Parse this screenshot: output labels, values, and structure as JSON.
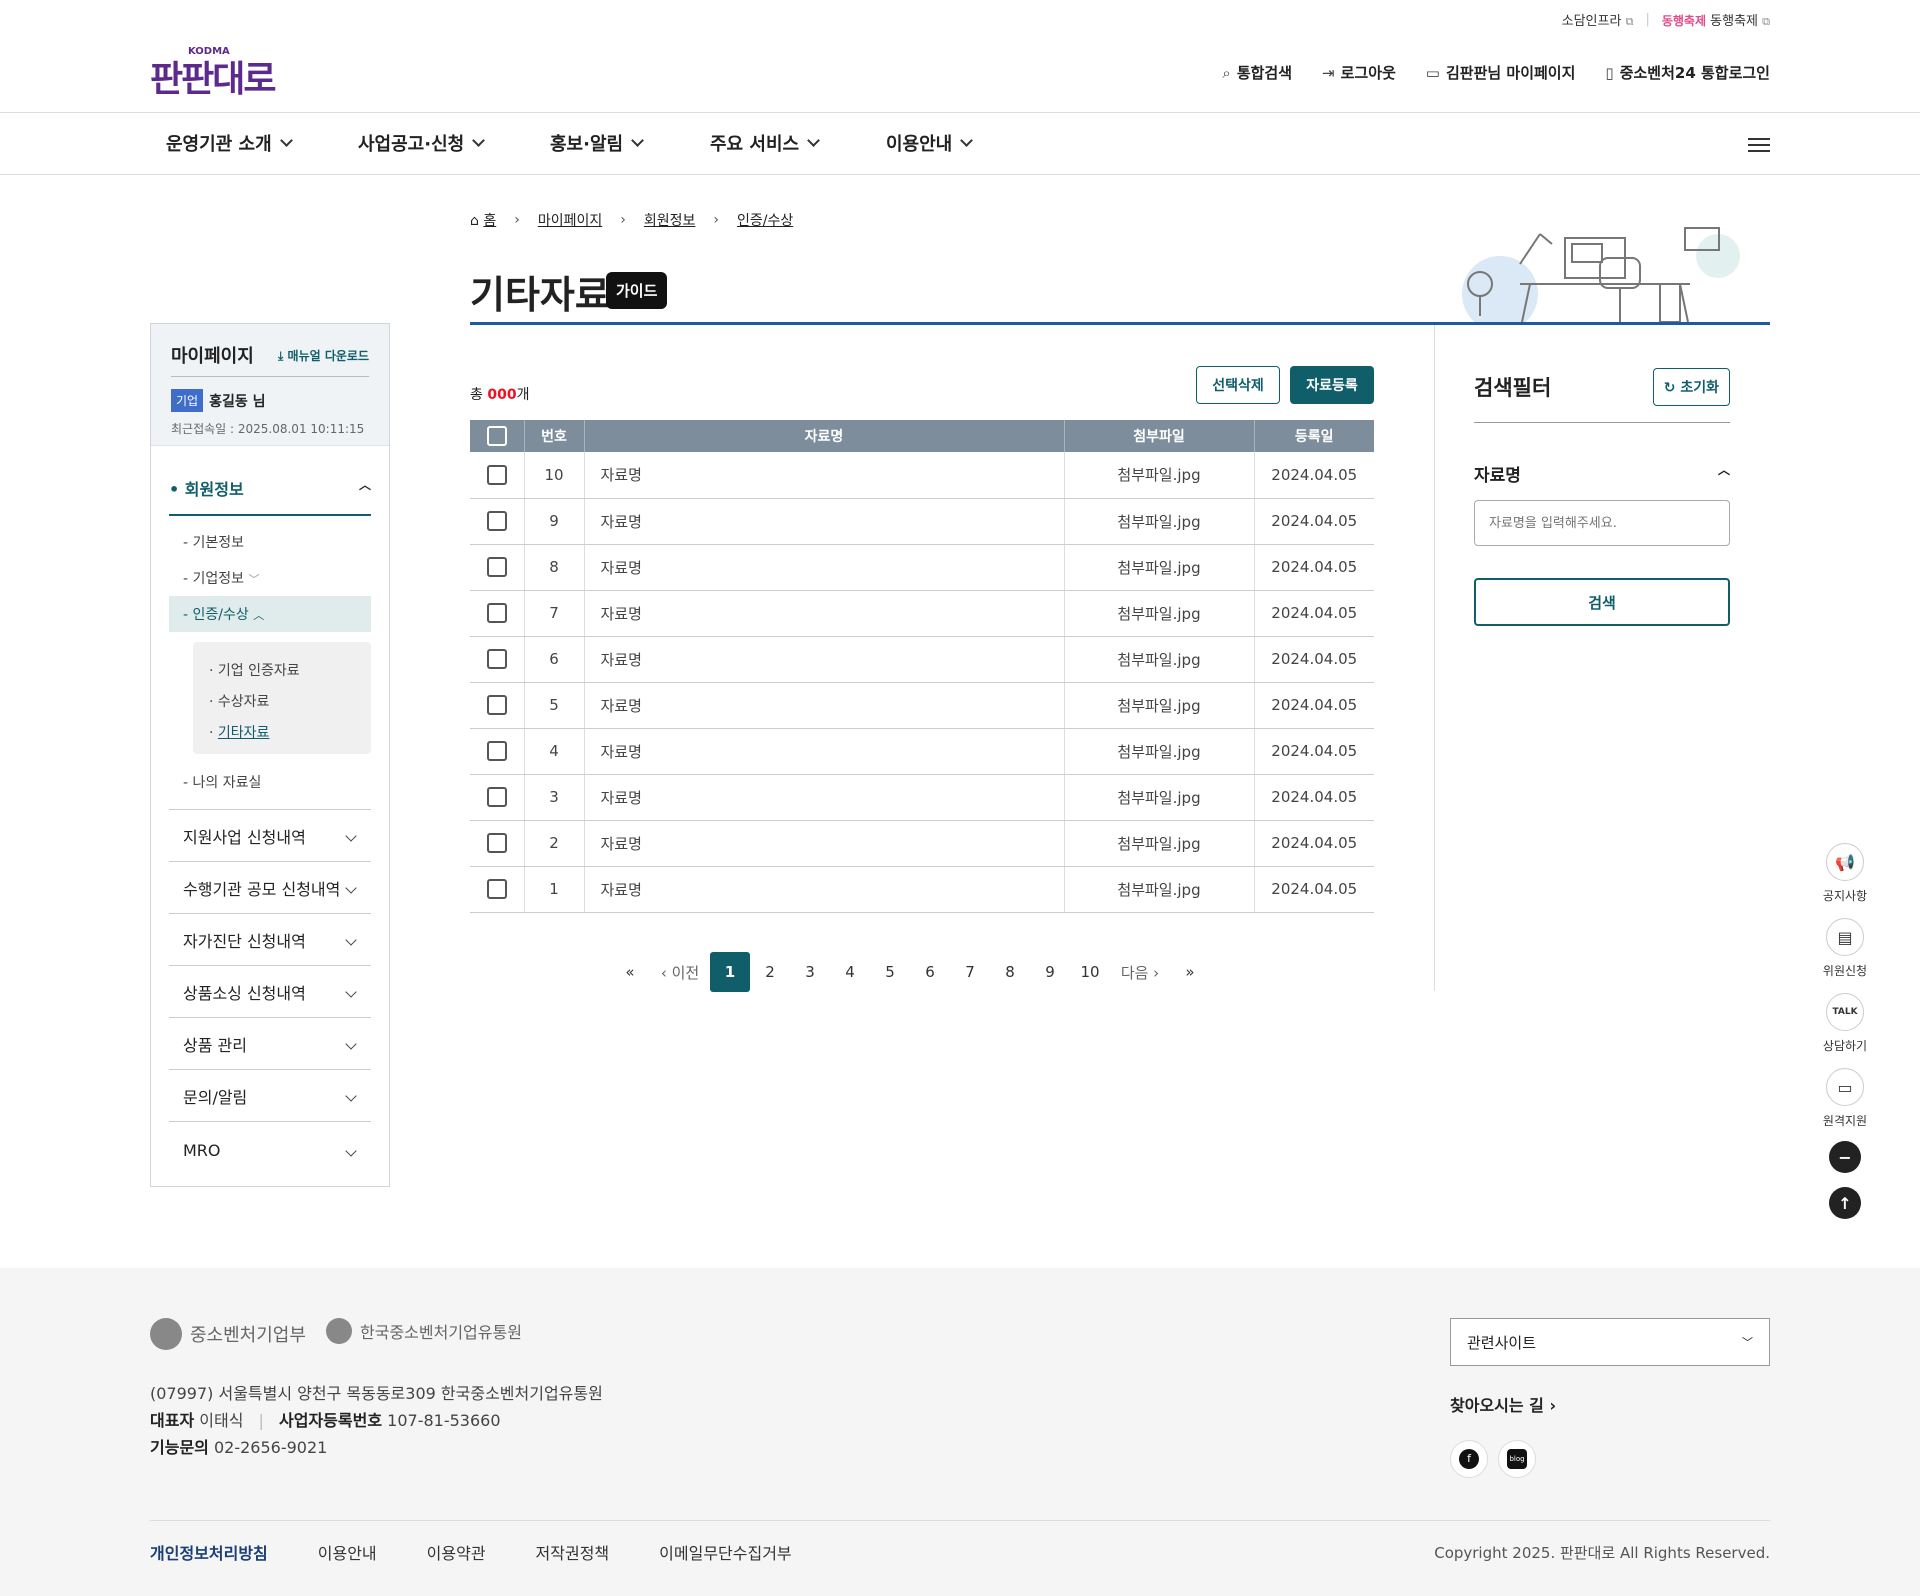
{
  "util": {
    "item1": "소담인프라",
    "item2": "동행축제",
    "item2_logo": "동행축제"
  },
  "logo": {
    "text": "판판대로",
    "sub": "KODMA"
  },
  "topnav": [
    {
      "icon": "search-icon",
      "label": "통합검색"
    },
    {
      "icon": "logout-icon",
      "label": "로그아웃"
    },
    {
      "icon": "book-icon",
      "label": "김판판님 마이페이지"
    },
    {
      "icon": "id-icon",
      "label": "중소벤처24 통합로그인"
    }
  ],
  "gnb": [
    "운영기관 소개",
    "사업공고·신청",
    "홍보·알림",
    "주요 서비스",
    "이용안내"
  ],
  "breadcrumb": [
    "홈",
    "마이페이지",
    "회원정보",
    "인증/수상"
  ],
  "page": {
    "title": "기타자료",
    "guide": "가이드"
  },
  "sidebar": {
    "title": "마이페이지",
    "manual": "매뉴얼 다운로드",
    "user_tag": "기업",
    "user_name": "홍길동 님",
    "last_login": "최근접속일 : 2025.08.01 10:11:15",
    "section": "회원정보",
    "subs": [
      "- 기본정보",
      "- 기업정보",
      "- 인증/수상",
      "- 나의 자료실"
    ],
    "subsub": [
      "· 기업 인증자료",
      "· 수상자료",
      "· 기타자료"
    ],
    "menus": [
      "지원사업 신청내역",
      "수행기관 공모 신청내역",
      "자가진단 신청내역",
      "상품소싱 신청내역",
      "상품 관리",
      "문의/알림",
      "MRO"
    ]
  },
  "list": {
    "total_prefix": "총 ",
    "total": "000",
    "total_suffix": "개",
    "btn_delete": "선택삭제",
    "btn_register": "자료등록",
    "columns": [
      "번호",
      "자료명",
      "첨부파일",
      "등록일"
    ],
    "rows": [
      {
        "no": "10",
        "name": "자료명",
        "file": "첨부파일.jpg",
        "date": "2024.04.05"
      },
      {
        "no": "9",
        "name": "자료명",
        "file": "첨부파일.jpg",
        "date": "2024.04.05"
      },
      {
        "no": "8",
        "name": "자료명",
        "file": "첨부파일.jpg",
        "date": "2024.04.05"
      },
      {
        "no": "7",
        "name": "자료명",
        "file": "첨부파일.jpg",
        "date": "2024.04.05"
      },
      {
        "no": "6",
        "name": "자료명",
        "file": "첨부파일.jpg",
        "date": "2024.04.05"
      },
      {
        "no": "5",
        "name": "자료명",
        "file": "첨부파일.jpg",
        "date": "2024.04.05"
      },
      {
        "no": "4",
        "name": "자료명",
        "file": "첨부파일.jpg",
        "date": "2024.04.05"
      },
      {
        "no": "3",
        "name": "자료명",
        "file": "첨부파일.jpg",
        "date": "2024.04.05"
      },
      {
        "no": "2",
        "name": "자료명",
        "file": "첨부파일.jpg",
        "date": "2024.04.05"
      },
      {
        "no": "1",
        "name": "자료명",
        "file": "첨부파일.jpg",
        "date": "2024.04.05"
      }
    ]
  },
  "pager": {
    "first": "«",
    "prev": "‹ 이전",
    "pages": [
      "1",
      "2",
      "3",
      "4",
      "5",
      "6",
      "7",
      "8",
      "9",
      "10"
    ],
    "current": "1",
    "next": "다음 ›",
    "last": "»"
  },
  "filter": {
    "title": "검색필터",
    "reset": "초기화",
    "label": "자료명",
    "placeholder": "자료명을 입력해주세요.",
    "search": "검색"
  },
  "floating": [
    {
      "icon": "megaphone-icon",
      "label": "공지사항"
    },
    {
      "icon": "clipboard-icon",
      "label": "위원신청"
    },
    {
      "icon": "talk-icon",
      "label": "상담하기"
    },
    {
      "icon": "laptop-icon",
      "label": "원격지원"
    }
  ],
  "footer": {
    "org1": "중소벤처기업부",
    "org2": "한국중소벤처기업유통원",
    "address": "(07997) 서울특별시 양천구 목동동로309 한국중소벤처기업유통원",
    "rep_label": "대표자",
    "rep": "이태식",
    "biz_label": "사업자등록번호",
    "biz": "107-81-53660",
    "tech_label": "기능문의",
    "tech": "02-2656-9021",
    "related": "관련사이트",
    "directions": "찾아오시는 길 ›",
    "links": [
      "개인정보처리방침",
      "이용안내",
      "이용약관",
      "저작권정책",
      "이메일무단수집거부"
    ],
    "copyright": "Copyright 2025. 판판대로 All Rights Reserved."
  }
}
